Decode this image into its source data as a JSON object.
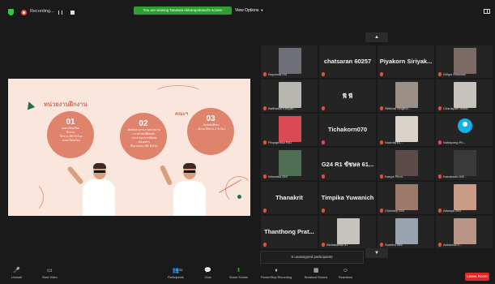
{
  "top_bar": {
    "recording_label": "Recording...",
    "share_banner": "You are viewing Tanawat Akkarapokasol's screen",
    "view_options": "View Options"
  },
  "slide": {
    "title": "หน่วยงานฝึกงาน",
    "side_label": "คณะฯ",
    "circles": [
      {
        "num": "01",
        "lines": [
          "ลงทะเบียนเรียน",
          "ฝึกงาน",
          "- ฝึกงาน 280 ชั่วโมง",
          "- ลงทะเบียนเรียน"
        ]
      },
      {
        "num": "02",
        "lines": [
          "- ติดต่อประสานงานหน่วยงาน",
          "- การทำหนังสือส่งตัว",
          "- ประสานอาจารย์นิเทศ",
          "- ส่งเอกสาร",
          "- ฝึกงานครบ 280 ชั่วโมง"
        ]
      },
      {
        "num": "03",
        "lines": [
          "- นิเทศนักศึกษา",
          "- สัมมนาฝึกงาน 3 ชั่วโมง"
        ]
      }
    ]
  },
  "gallery": {
    "tiles": [
      {
        "type": "photo",
        "label": "Nuparnan 04",
        "photo_color": "#6f6f78"
      },
      {
        "type": "name",
        "name": "chatsaran 60257"
      },
      {
        "type": "name",
        "name": "Piyakorn Siriyak..."
      },
      {
        "type": "photo",
        "label": "Kittiya Srisuwan",
        "photo_color": "#7b6a66"
      },
      {
        "type": "photo",
        "label": "Natthakul Kanyab...",
        "photo_color": "#b8b6b0"
      },
      {
        "type": "name",
        "name": "ฟี ฟี"
      },
      {
        "type": "photo",
        "label": "Sittichai Singtho...",
        "photo_color": "#9c8f86"
      },
      {
        "type": "photo",
        "label": "Chanayuth Naktu",
        "photo_color": "#c7c2bc"
      },
      {
        "type": "photo",
        "label": "Pinyaphitsa R61",
        "photo_color": "#d94a55"
      },
      {
        "type": "name",
        "name": "Tichakorn070"
      },
      {
        "type": "photo",
        "label": "Nuanda 61...",
        "photo_color": "#d9d3cc"
      },
      {
        "type": "default",
        "label": "Nuttapong Ph..."
      },
      {
        "type": "photo",
        "label": "Wanwisa 050",
        "photo_color": "#4f6f55"
      },
      {
        "type": "name",
        "name": "G24 R1 ขัชษล 61..."
      },
      {
        "type": "photo",
        "label": "Kanya Phon...",
        "photo_color": "#5b4a48"
      },
      {
        "type": "photo",
        "label": "Kanokwan 049",
        "photo_color": "#3a3a3a"
      },
      {
        "type": "name",
        "name": "Thanakrit"
      },
      {
        "type": "name",
        "name": "Timpika Yuwanich"
      },
      {
        "type": "photo",
        "label": "Chindary 055",
        "photo_color": "#9b7a6a"
      },
      {
        "type": "photo",
        "label": "Atiwaya 063",
        "photo_color": "#c99a86"
      },
      {
        "type": "name",
        "name": "Thanthong Prat..."
      },
      {
        "type": "photo",
        "label": "Nichakamol 51",
        "photo_color": "#c6c3bc"
      },
      {
        "type": "photo",
        "label": "Sumitra 066",
        "photo_color": "#9aa4b0"
      },
      {
        "type": "photo",
        "label": "Aekachai 0...",
        "photo_color": "#b89584"
      }
    ],
    "unassigned": "5 unassigned participants"
  },
  "toolbar": {
    "buttons": [
      {
        "label": "Unmute",
        "icon": "mic-muted-icon"
      },
      {
        "label": "Start Video",
        "icon": "video-off-icon"
      },
      {
        "label": "Participants",
        "icon": "participants-icon",
        "count": "35"
      },
      {
        "label": "Chat",
        "icon": "chat-icon"
      },
      {
        "label": "Share Screen",
        "icon": "share-screen-icon"
      },
      {
        "label": "Pause/Stop Recording",
        "icon": "recording-icon"
      },
      {
        "label": "Breakout Rooms",
        "icon": "breakout-rooms-icon"
      },
      {
        "label": "Reactions",
        "icon": "reactions-icon"
      }
    ],
    "leave": "Leave Room"
  },
  "colors": {
    "share_green": "#2e9e33",
    "leave_red": "#e02828",
    "slide_bg": "#fbe6dd",
    "slide_accent": "#e0836d"
  }
}
